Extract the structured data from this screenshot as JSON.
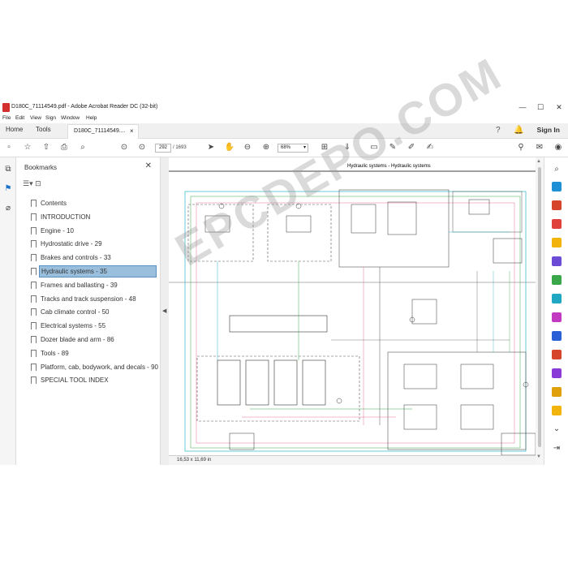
{
  "app": {
    "title": "D180C_71114549.pdf - Adobe Acrobat Reader DC (32-bit)",
    "window_controls": [
      "—",
      "☐",
      "✕"
    ]
  },
  "menu": [
    "File",
    "Edit",
    "View",
    "Sign",
    "Window",
    "Help"
  ],
  "tabs": {
    "home": "Home",
    "tools": "Tools",
    "document": "D180C_71114549....",
    "close": "×"
  },
  "header_right": {
    "help_icon": "help-icon",
    "bell_icon": "bell-icon",
    "sign_in": "Sign In"
  },
  "toolbar": {
    "page_current": "292",
    "page_total": "/  1693",
    "zoom": "68%"
  },
  "bookmarks": {
    "header": "Bookmarks",
    "selected_index": 5,
    "items": [
      "Contents",
      "INTRODUCTION",
      "Engine - 10",
      "Hydrostatic drive - 29",
      "Brakes and controls - 33",
      "Hydraulic systems - 35",
      "Frames and ballasting - 39",
      "Tracks and track suspension - 48",
      "Cab climate control - 50",
      "Electrical systems - 55",
      "Dozer blade and arm - 86",
      "Tools - 89",
      "Platform, cab, bodywork, and decals - 90",
      "SPECIAL TOOL INDEX"
    ]
  },
  "document": {
    "page_title": "Hydraulic systems - Hydraulic systems",
    "page_size": "16,53 x 11,69 in",
    "watermark": "EPCDEPO.COM"
  },
  "colors": {
    "selection": "#99bfdc",
    "pdf_red": "#d32f2f",
    "wire_cyan": "#2bb5c9",
    "wire_green": "#3aa84a",
    "wire_pink": "#e070a0",
    "wire_gray": "#555555"
  }
}
